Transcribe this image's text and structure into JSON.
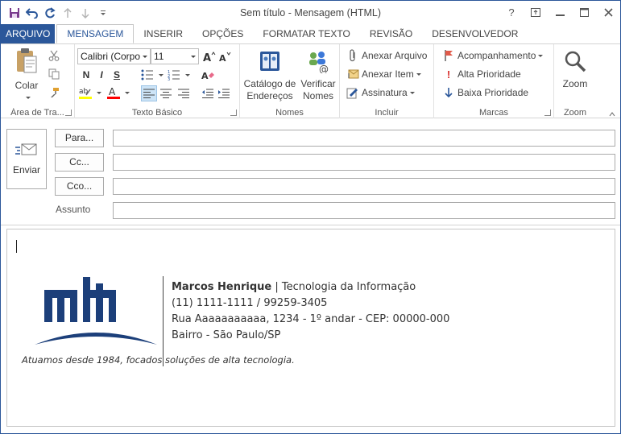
{
  "window": {
    "title": "Sem título - Mensagem (HTML)",
    "controls": {
      "help": "?",
      "ribbon_display": "⇱",
      "minimize": "–",
      "maximize": "☐",
      "close": "✕"
    }
  },
  "quick_access": [
    {
      "name": "save-icon",
      "glyph": "💾"
    },
    {
      "name": "undo-icon",
      "glyph": "↶"
    },
    {
      "name": "redo-icon",
      "glyph": "↻"
    },
    {
      "name": "up-arrow-icon",
      "glyph": "↑"
    },
    {
      "name": "down-arrow-icon",
      "glyph": "↓"
    },
    {
      "name": "customize-icon",
      "glyph": "▾"
    }
  ],
  "tabs": [
    "ARQUIVO",
    "MENSAGEM",
    "INSERIR",
    "OPÇÕES",
    "FORMATAR TEXTO",
    "REVISÃO",
    "DESENVOLVEDOR"
  ],
  "ribbon": {
    "clipboard": {
      "paste": "Colar",
      "label": "Área de Tra..."
    },
    "basic_text": {
      "font": "Calibri (Corpo",
      "size": "11",
      "bold": "N",
      "italic": "I",
      "underline": "S",
      "label": "Texto Básico"
    },
    "names": {
      "address_book_1": "Catálogo de",
      "address_book_2": "Endereços",
      "check_1": "Verificar",
      "check_2": "Nomes",
      "label": "Nomes"
    },
    "include": {
      "attach_file": "Anexar Arquivo",
      "attach_item": "Anexar Item",
      "signature": "Assinatura",
      "label": "Incluir"
    },
    "tags": {
      "follow_up": "Acompanhamento",
      "high": "Alta Prioridade",
      "low": "Baixa Prioridade",
      "label": "Marcas"
    },
    "zoom": {
      "button": "Zoom",
      "label": "Zoom"
    }
  },
  "compose": {
    "send": "Enviar",
    "to": "Para...",
    "cc": "Cc...",
    "bcc": "Cco...",
    "subject_label": "Assunto",
    "to_value": "",
    "cc_value": "",
    "bcc_value": "",
    "subject_value": ""
  },
  "signature": {
    "name": "Marcos Henrique",
    "dept": " | Tecnologia da Informação",
    "phone": "(11) 1111-1111 / 99259-3405",
    "address": "Rua Aaaaaaaaaaa, 1234 - 1º andar - CEP: 00000-000",
    "district": "Bairro - São Paulo/SP",
    "tagline": "Atuamos desde 1984, focados soluções de alta tecnologia."
  },
  "colors": {
    "accent": "#2b579a",
    "logo": "#1c3f7a",
    "highlight": "#ffff00",
    "font_color": "#ff0000"
  }
}
